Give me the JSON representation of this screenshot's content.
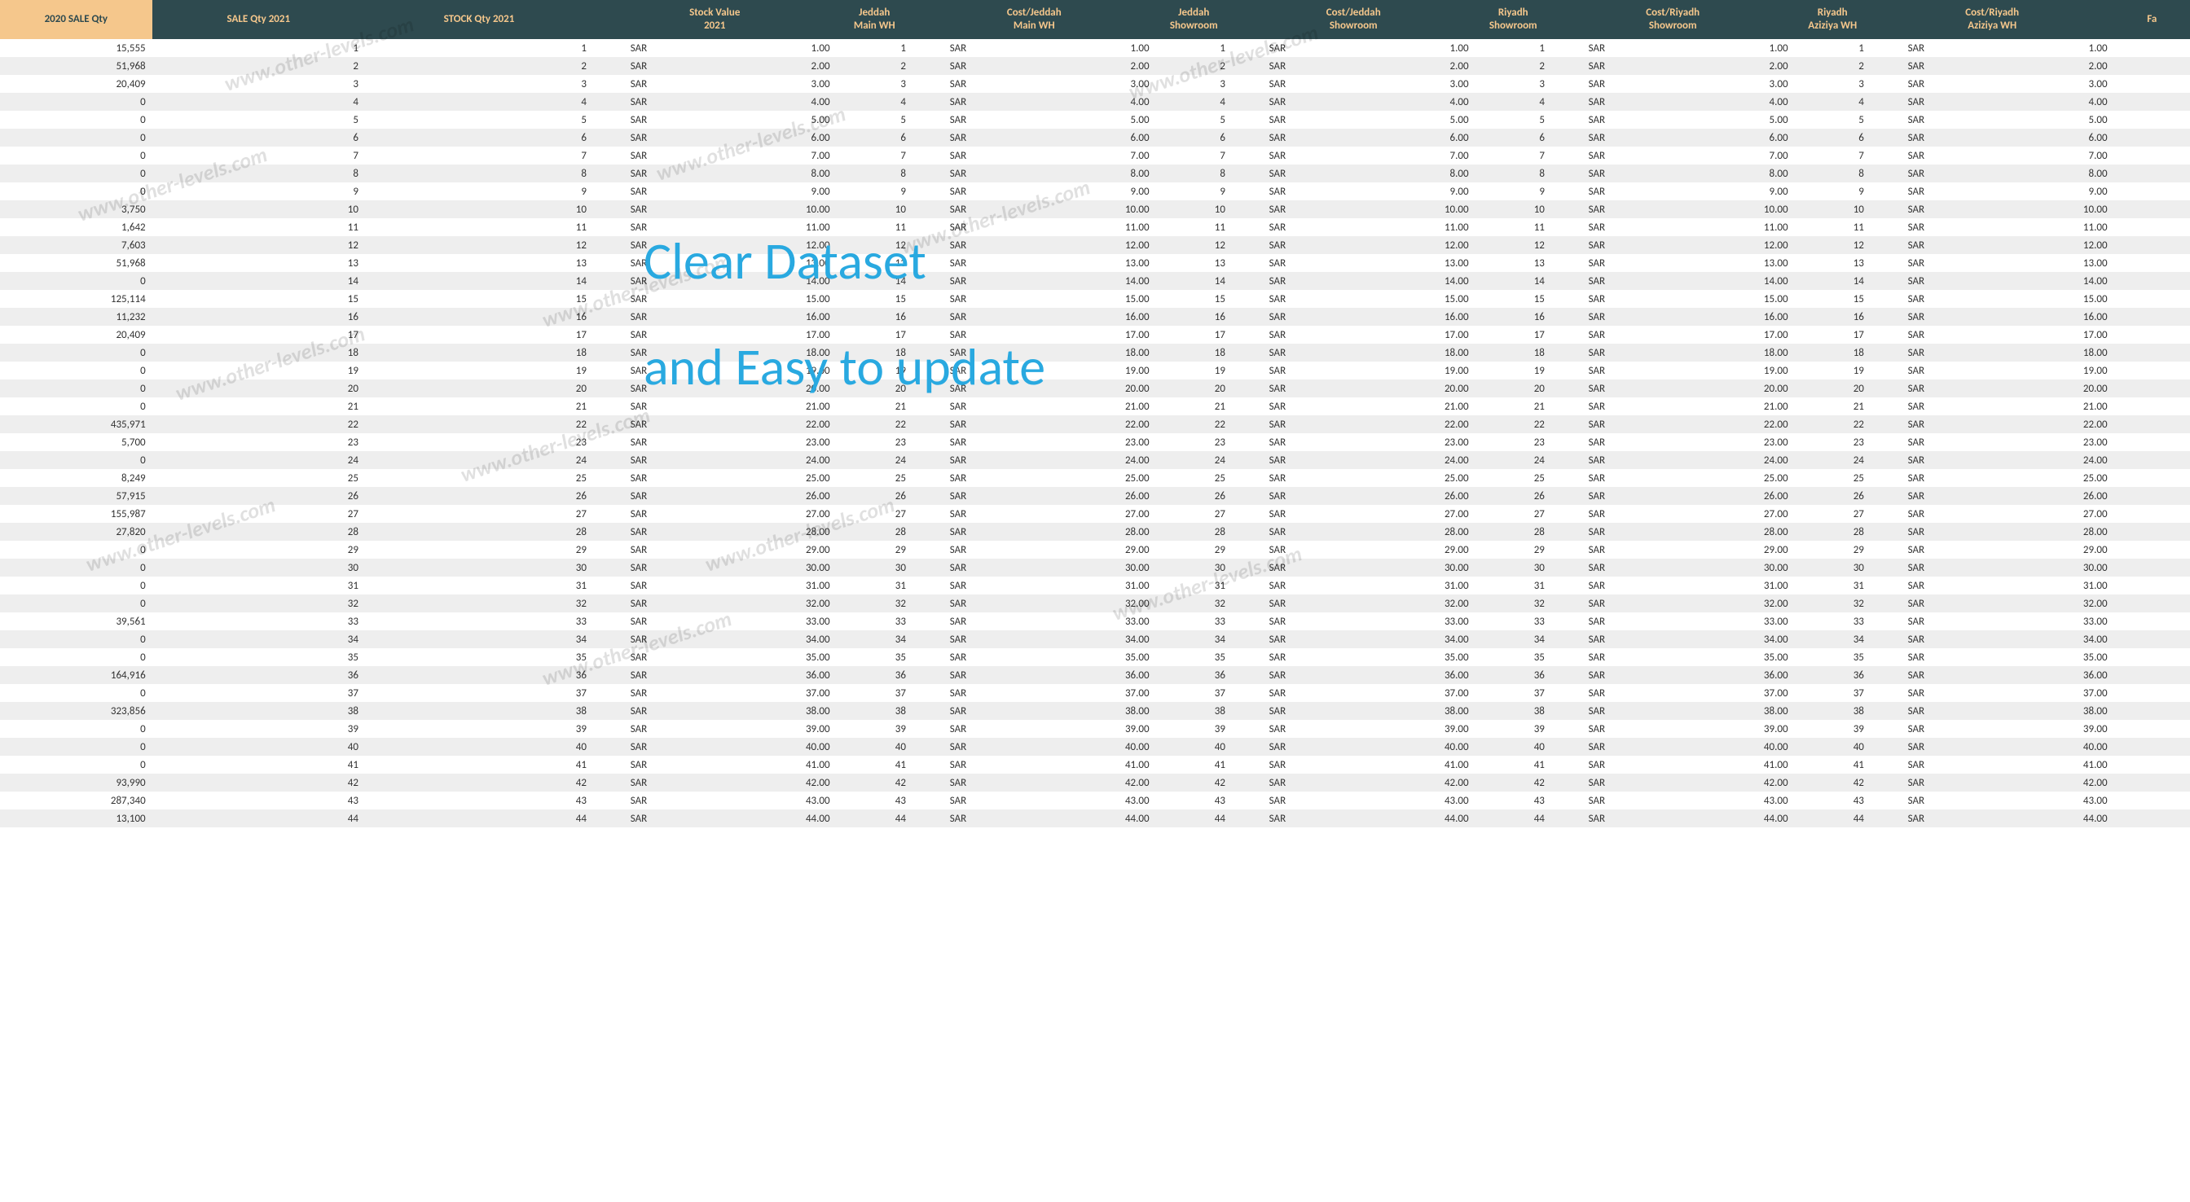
{
  "headers": [
    "2020 SALE Qty",
    "SALE Qty 2021",
    "STOCK Qty 2021",
    "Stock Value\n2021",
    "Jeddah\nMain WH",
    "Cost/Jeddah\nMain WH",
    "Jeddah\nShowroom",
    "Cost/Jeddah\nShowroom",
    "Riyadh\nShowroom",
    "Cost/Riyadh\nShowroom",
    "Riyadh\nAziziya WH",
    "Cost/Riyadh\nAziziya WH",
    "Fa"
  ],
  "currency": "SAR",
  "sale2020": [
    "15,555",
    "51,968",
    "20,409",
    "0",
    "0",
    "0",
    "0",
    "0",
    "0",
    "3,750",
    "1,642",
    "7,603",
    "51,968",
    "0",
    "125,114",
    "11,232",
    "20,409",
    "0",
    "0",
    "0",
    "0",
    "435,971",
    "5,700",
    "0",
    "8,249",
    "57,915",
    "155,987",
    "27,820",
    "0",
    "0",
    "0",
    "0",
    "39,561",
    "0",
    "0",
    "164,916",
    "0",
    "323,856",
    "0",
    "0",
    "0",
    "93,990",
    "287,340",
    "13,100"
  ],
  "overlay": {
    "line1": "Clear Dataset",
    "line2": "and Easy to update"
  },
  "watermark_text": "www.other-levels.com"
}
